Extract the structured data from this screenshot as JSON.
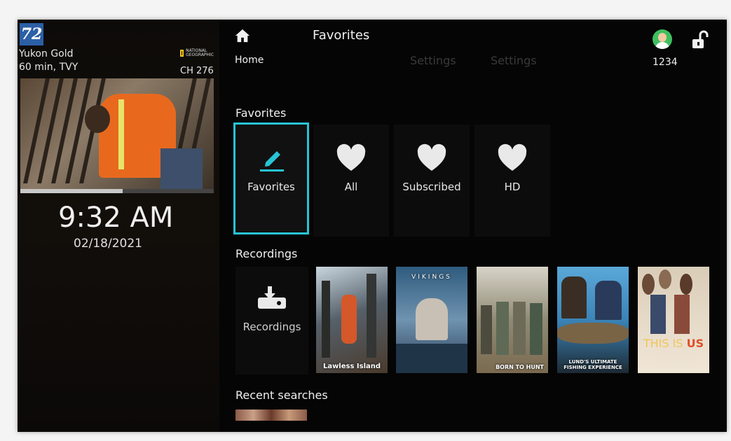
{
  "now_playing": {
    "channel_logo": "72",
    "title": "Yukon Gold",
    "meta": "60 min, TVY",
    "network_logo": "NATIONAL GEOGRAPHIC",
    "channel": "CH 276",
    "progress": 0.53
  },
  "clock": {
    "time": "9:32 AM",
    "date": "02/18/2021"
  },
  "header": {
    "home_label": "Home",
    "title": "Favorites",
    "ghost_items": [
      "Settings",
      "Settings"
    ],
    "pin": "1234"
  },
  "favorites": {
    "heading": "Favorites",
    "tiles": [
      {
        "label": "Favorites",
        "icon": "pencil-icon",
        "selected": true
      },
      {
        "label": "All",
        "icon": "heart-icon"
      },
      {
        "label": "Subscribed",
        "icon": "heart-icon"
      },
      {
        "label": "HD",
        "icon": "heart-icon"
      }
    ]
  },
  "recordings": {
    "heading": "Recordings",
    "tile_label": "Recordings",
    "posters": [
      {
        "caption": "Lawless Island"
      },
      {
        "caption": "VIKINGS"
      },
      {
        "caption": "BORN TO HUNT"
      },
      {
        "caption": "LUND'S ULTIMATE FISHING EXPERIENCE"
      },
      {
        "brand_a": "THIS IS ",
        "brand_b": "US"
      }
    ]
  },
  "recent": {
    "heading": "Recent searches"
  },
  "colors": {
    "accent": "#27c5d6",
    "background": "#050505",
    "avatar": "#3fbf5f"
  }
}
